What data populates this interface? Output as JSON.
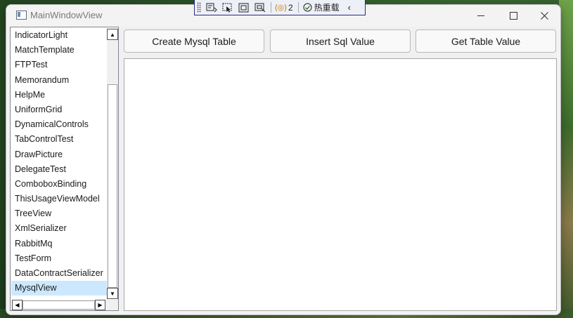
{
  "window": {
    "title": "MainWindowView"
  },
  "debug_toolbar": {
    "bindings_count": "2",
    "hot_reload_label": "热重载"
  },
  "sidebar": {
    "items": [
      "IndicatorLight",
      "MatchTemplate",
      "FTPTest",
      "Memorandum",
      "HelpMe",
      "UniformGrid",
      "DynamicalControls",
      "TabControlTest",
      "DrawPicture",
      "DelegateTest",
      "ComboboxBinding",
      "ThisUsageViewModel",
      "TreeView",
      "XmlSerializer",
      "RabbitMq",
      "TestForm",
      "DataContractSerializer",
      "MysqlView"
    ],
    "selected_index": 17
  },
  "buttons": {
    "create": "Create Mysql Table",
    "insert": "Insert Sql Value",
    "get": "Get Table Value"
  }
}
